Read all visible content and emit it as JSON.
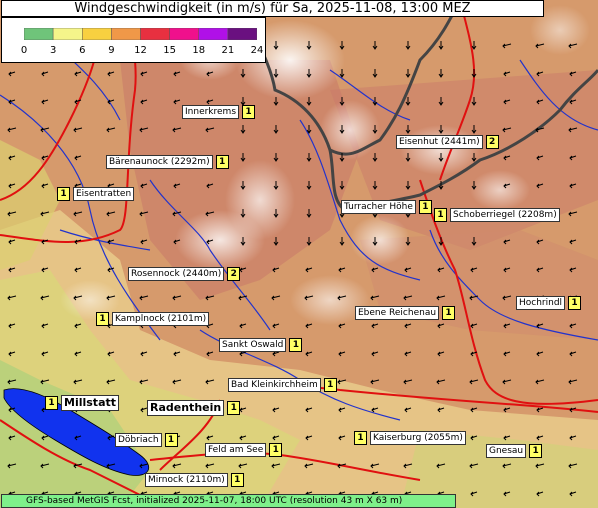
{
  "title": "Windgeschwindigkeit (in m/s) für Sa, 2025-11-08, 13:00 MEZ",
  "legend": {
    "ticks": [
      "0",
      "3",
      "6",
      "9",
      "12",
      "15",
      "18",
      "21",
      "24"
    ],
    "colors": [
      "#6fc47a",
      "#f5f58a",
      "#f8d040",
      "#f09848",
      "#e83040",
      "#f0108c",
      "#b010e8",
      "#6a1080"
    ]
  },
  "footer": "GFS-based MetGIS Fcst, initialized 2025-11-07, 18:00 UTC  (resolution 43 m X 63 m)",
  "places": [
    {
      "name": "Innerkrems",
      "value": "1"
    },
    {
      "name": "Bärenaunock (2292m)",
      "value": "1"
    },
    {
      "name": "Eisentratten",
      "value": "1"
    },
    {
      "name": "Eisenhut (2441m)",
      "value": "2"
    },
    {
      "name": "Turracher Höhe",
      "value": "1"
    },
    {
      "name": "Schoberriegel (2208m)",
      "value": "1"
    },
    {
      "name": "Rosennock (2440m)",
      "value": "2"
    },
    {
      "name": "Hochrindl",
      "value": "1"
    },
    {
      "name": "Kamplnock (2101m)",
      "value": "1"
    },
    {
      "name": "Ebene Reichenau",
      "value": "1"
    },
    {
      "name": "Sankt Oswald",
      "value": "1"
    },
    {
      "name": "Bad Kleinkirchheim",
      "value": "1"
    },
    {
      "name": "Millstatt",
      "value": "1"
    },
    {
      "name": "Radenthein",
      "value": "1"
    },
    {
      "name": "Döbriach",
      "value": "1"
    },
    {
      "name": "Kaiserburg (2055m)",
      "value": "1"
    },
    {
      "name": "Feld am See",
      "value": "1"
    },
    {
      "name": "Gnesau",
      "value": "1"
    },
    {
      "name": "Mirnock (2110m)",
      "value": "1"
    }
  ]
}
